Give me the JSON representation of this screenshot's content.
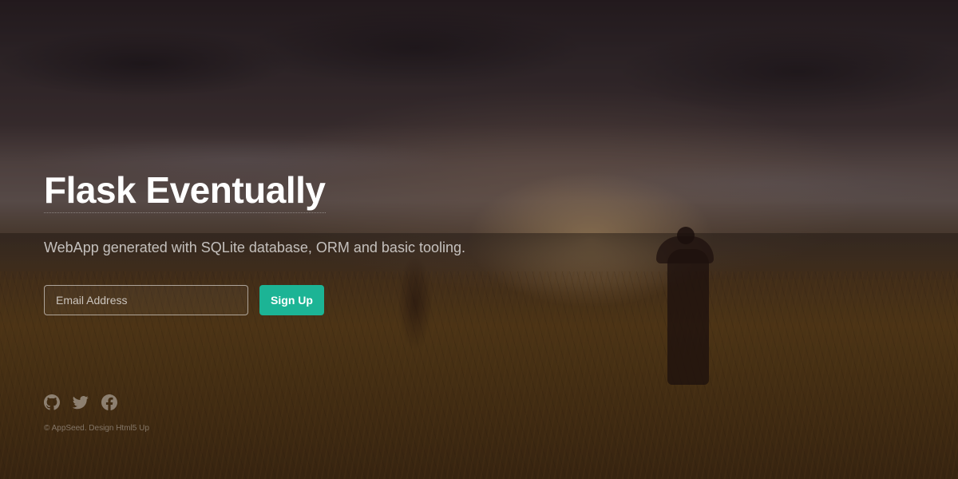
{
  "header": {
    "title": "Flask Eventually",
    "subtitle": "WebApp generated with SQLite database, ORM and basic tooling."
  },
  "signup_form": {
    "email_placeholder": "Email Address",
    "email_value": "",
    "submit_label": "Sign Up"
  },
  "social": {
    "icons": [
      "github-icon",
      "twitter-icon",
      "facebook-icon"
    ]
  },
  "footer": {
    "copyright": "© AppSeed. Design Html5 Up"
  },
  "colors": {
    "accent": "#1cb495",
    "text": "#ffffff"
  }
}
